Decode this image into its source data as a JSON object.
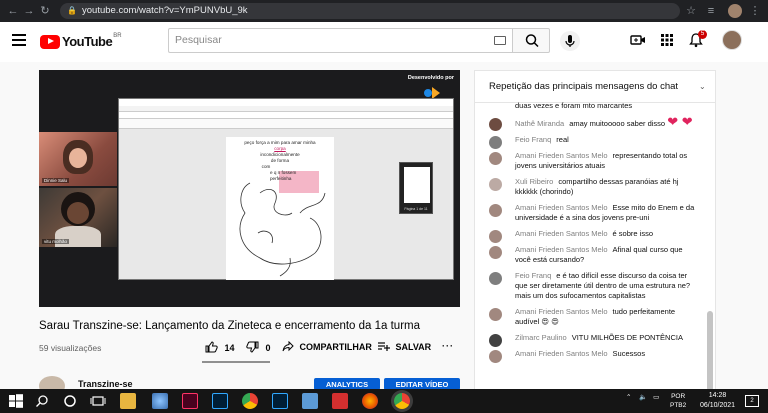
{
  "browser": {
    "url": "youtube.com/watch?v=YmPUNVbU_9k"
  },
  "header": {
    "logo_text": "YouTube",
    "country_code": "BR",
    "search_placeholder": "Pesquisar",
    "notification_count": "5"
  },
  "player": {
    "developed_by": "Desenvolvido por",
    "participants": [
      {
        "name": "Dinnie Salu"
      },
      {
        "name": "vitu molhão"
      }
    ],
    "shared_document_lines": [
      "peço força a mim para amar minha",
      "corpa",
      "incondicionalmente",
      "de forma",
      "com",
      "e q n fossem",
      "perfeitinha"
    ],
    "thumbnail_label": "Página 1 de 11"
  },
  "video": {
    "title": "Sarau Transzine-se: Lançamento da Zineteca e encerramento da 1a turma",
    "views": "59 visualizações",
    "likes": "14",
    "dislikes": "0",
    "share_label": "COMPARTILHAR",
    "save_label": "SALVAR",
    "channel_name": "Transzine-se",
    "analytics_label": "ANALYTICS",
    "edit_label": "EDITAR VÍDEO"
  },
  "chat": {
    "header": "Repetição das principais mensagens do chat",
    "messages": [
      {
        "author": "",
        "text": "duas vezes e foram mto marcantes",
        "color": "#b0b0b0"
      },
      {
        "author": "Nathê Miranda",
        "text": "amay muitooooo saber disso",
        "color": "#6d4c41",
        "hearts": "❤ ❤"
      },
      {
        "author": "Feio Franq",
        "text": "real",
        "color": "#7e7e7e"
      },
      {
        "author": "Amani Frieden Santos Melo",
        "text": "representando total os jovens universitários atuais",
        "color": "#a1887f"
      },
      {
        "author": "Xuli Ribeiro",
        "text": "compartilho dessas paranóias até hj kkkkkk (chorindo)",
        "color": "#bcaaa4"
      },
      {
        "author": "Amani Frieden Santos Melo",
        "text": "Esse mito do Enem e da universidade é a sina dos jovens pre-uni",
        "color": "#a1887f"
      },
      {
        "author": "Amani Frieden Santos Melo",
        "text": "é sobre isso",
        "color": "#a1887f"
      },
      {
        "author": "Amani Frieden Santos Melo",
        "text": "Afinal qual curso que você está cursando?",
        "color": "#a1887f"
      },
      {
        "author": "Feio Franq",
        "text": "e é tao difícil esse discurso da coisa ter que ser diretamente útil dentro de uma estrutura ne? mais um dos sufocamentos capitalistas",
        "color": "#7e7e7e"
      },
      {
        "author": "Amani Frieden Santos Melo",
        "text": "tudo perfeitamente audível",
        "color": "#a1887f",
        "emoji": "😍 😍"
      },
      {
        "author": "Zilmarc Paulino",
        "text": "VITU MILHÕES DE PONTÊNCIA",
        "color": "#424242"
      },
      {
        "author": "Amani Frieden Santos Melo",
        "text": "Sucessos",
        "color": "#a1887f"
      }
    ]
  },
  "taskbar": {
    "lang": "POR",
    "layout": "PTB2",
    "time": "14:28",
    "date": "06/10/2021",
    "notif": "2"
  }
}
